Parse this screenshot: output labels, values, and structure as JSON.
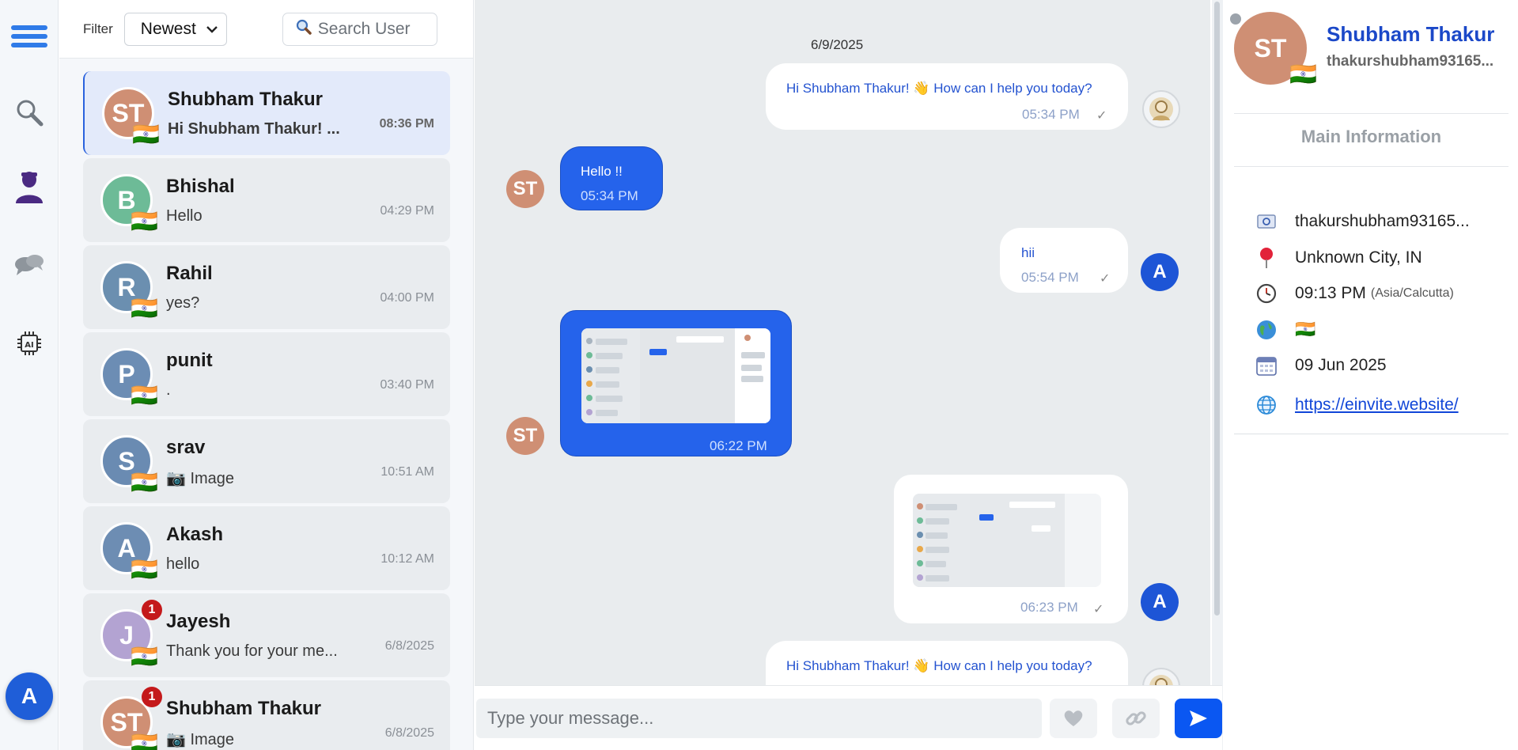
{
  "sidebar_nav": {
    "items": [
      "menu-icon",
      "search-icon",
      "user-icon",
      "chat-icon",
      "ai-chip-icon"
    ],
    "current_user_initial": "A"
  },
  "filter": {
    "label": "Filter",
    "selected": "Newest",
    "search_placeholder": "Search User"
  },
  "contacts": [
    {
      "initials": "ST",
      "name": "Shubham Thakur",
      "last_message": "Hi Shubham Thakur! ...",
      "time": "08:36 PM",
      "avatar_color": "#cf8f74",
      "flag": "🇮🇳",
      "active": true,
      "unread": ""
    },
    {
      "initials": "B",
      "name": "Bhishal",
      "last_message": "Hello",
      "time": "04:29 PM",
      "avatar_color": "#6dbb97",
      "flag": "🇮🇳",
      "active": false,
      "unread": ""
    },
    {
      "initials": "R",
      "name": "Rahil",
      "last_message": "yes?",
      "time": "04:00 PM",
      "avatar_color": "#6b8fb0",
      "flag": "🇮🇳",
      "active": false,
      "unread": ""
    },
    {
      "initials": "P",
      "name": "punit",
      "last_message": ".",
      "time": "03:40 PM",
      "avatar_color": "#6c8db4",
      "flag": "🇮🇳",
      "active": false,
      "unread": ""
    },
    {
      "initials": "S",
      "name": "srav",
      "last_message": "📷 Image",
      "time": "10:51 AM",
      "avatar_color": "#6a8bb2",
      "flag": "🇮🇳",
      "active": false,
      "unread": ""
    },
    {
      "initials": "A",
      "name": "Akash",
      "last_message": "hello",
      "time": "10:12 AM",
      "avatar_color": "#6d8db3",
      "flag": "🇮🇳",
      "active": false,
      "unread": ""
    },
    {
      "initials": "J",
      "name": "Jayesh",
      "last_message": "Thank you for your me...",
      "time": "6/8/2025",
      "avatar_color": "#b3a3d2",
      "flag": "🇮🇳",
      "active": false,
      "unread": "1"
    },
    {
      "initials": "ST",
      "name": "Shubham Thakur",
      "last_message": "📷 Image",
      "time": "6/8/2025",
      "avatar_color": "#cf8f74",
      "flag": "🇮🇳",
      "active": false,
      "unread": "1"
    }
  ],
  "chat": {
    "date": "6/9/2025",
    "messages": [
      {
        "direction": "out",
        "text": "Hi Shubham Thakur! 👋 How can I help you today?",
        "time": "05:34 PM",
        "sender": "bot"
      },
      {
        "direction": "in",
        "text": "Hello !!",
        "time": "05:34 PM",
        "sender": "ST"
      },
      {
        "direction": "out",
        "text": "hii",
        "time": "05:54 PM",
        "sender": "A"
      },
      {
        "direction": "in",
        "text": "",
        "time": "06:22 PM",
        "sender": "ST",
        "image": true
      },
      {
        "direction": "out",
        "text": "",
        "time": "06:23 PM",
        "sender": "A",
        "image": true
      },
      {
        "direction": "out",
        "text": "Hi Shubham Thakur! 👋 How can I help you today?",
        "time": "",
        "sender": "bot"
      }
    ],
    "read_tick": "✓",
    "composer_placeholder": "Type your message..."
  },
  "details": {
    "initials": "ST",
    "flag": "🇮🇳",
    "name": "Shubham Thakur",
    "handle": "thakurshubham93165...",
    "section_title": "Main Information",
    "email": "thakurshubham93165...",
    "location": "Unknown City, IN",
    "local_time": "09:13 PM",
    "timezone": "(Asia/Calcutta)",
    "country_flag": "🇮🇳",
    "date": " 09 Jun 2025",
    "website": "https://einvite.website/"
  },
  "colors": {
    "accent": "#2563eb",
    "brand_blue": "#1d55d6",
    "unread_badge": "#c4191b"
  }
}
